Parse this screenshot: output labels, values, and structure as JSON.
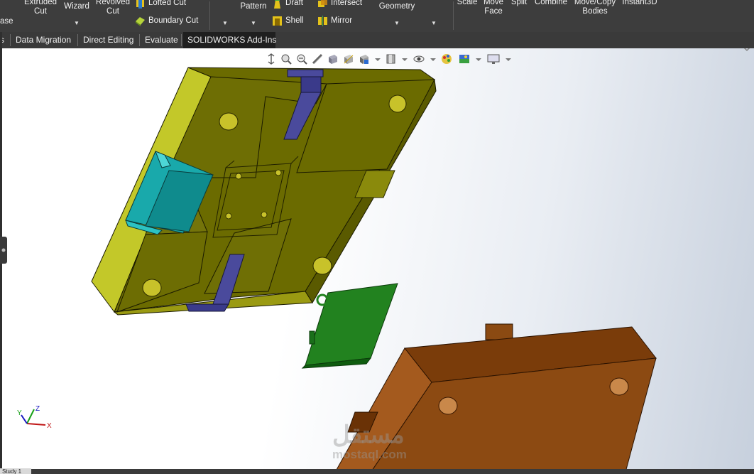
{
  "ribbon": {
    "partial_left": "ase",
    "extruded_cut": [
      "Extruded",
      "Cut"
    ],
    "hole_wizard": [
      "Wizard"
    ],
    "revolved_cut": [
      "Revolved",
      "Cut"
    ],
    "lofted_cut": "Lofted Cut",
    "boundary_cut": "Boundary Cut",
    "pattern": [
      "Pattern"
    ],
    "draft": "Draft",
    "shell": "Shell",
    "intersect": "Intersect",
    "mirror": "Mirror",
    "reference_geometry": [
      "Geometry"
    ],
    "scale": "Scale",
    "move_face": [
      "Move",
      "Face"
    ],
    "split": "Split",
    "combine": "Combine",
    "move_copy_bodies": [
      "Move/Copy",
      "Bodies"
    ],
    "instant3d": "Instant3D"
  },
  "tabs": [
    "s",
    "Data Migration",
    "Direct Editing",
    "Evaluate",
    "SOLIDWORKS Add-Ins"
  ],
  "heads_up_icons": [
    "zoom-to-fit-icon",
    "zoom-area-icon",
    "previous-view-icon",
    "section-view-icon",
    "dynamic-annotation-icon",
    "view-orientation-icon",
    "display-style-icon",
    "hide-show-icon",
    "edit-appearance-icon",
    "apply-scene-icon",
    "view-settings-icon"
  ],
  "triad": {
    "x": "X",
    "y": "Y",
    "z": "Z"
  },
  "watermark": {
    "arabic": "مستقل",
    "latin": "mostaql.com"
  },
  "status": {
    "tab": "Study 1"
  },
  "colors": {
    "mold_top": "#6b6b00",
    "mold_side": "#c5c92a",
    "slider": "#17a7a9",
    "core_pin": "#4b4b9b",
    "part": "#1f7f1f",
    "bottom_plate": "#8a4a12"
  }
}
